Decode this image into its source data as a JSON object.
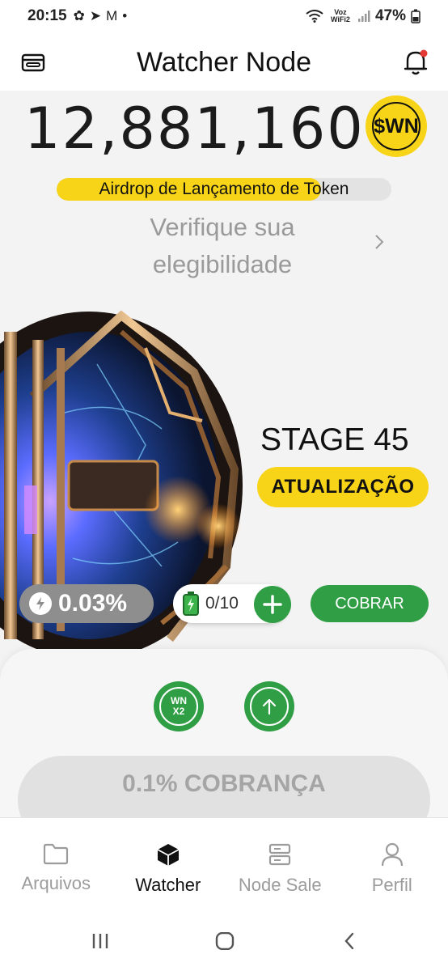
{
  "status_bar": {
    "time": "20:15",
    "network": "Voz WiFi2",
    "battery": "47%"
  },
  "header": {
    "title": "Watcher Node"
  },
  "balance": {
    "amount": "12,881,160",
    "token": "$WN"
  },
  "airdrop": {
    "label": "Airdrop de Lançamento de Token",
    "progress": 0.79
  },
  "verify": {
    "text": "Verifique sua elegibilidade"
  },
  "stage": {
    "label": "STAGE 45",
    "update_label": "ATUALIZAÇÃO"
  },
  "mining": {
    "rate": "0.03%",
    "energy": "0/10",
    "collect_label": "COBRAR"
  },
  "boosts": {
    "multiplier_line1": "WN",
    "multiplier_line2": "X2"
  },
  "charge": {
    "label": "0.1% COBRANÇA"
  },
  "nav": {
    "items": [
      {
        "label": "Arquivos",
        "icon": "folder-icon",
        "active": false
      },
      {
        "label": "Watcher",
        "icon": "cube-icon",
        "active": true
      },
      {
        "label": "Node Sale",
        "icon": "server-icon",
        "active": false
      },
      {
        "label": "Perfil",
        "icon": "person-icon",
        "active": false
      }
    ]
  },
  "colors": {
    "accent_yellow": "#f7d417",
    "accent_green": "#2f9e44",
    "background": "#f3f3f3"
  }
}
